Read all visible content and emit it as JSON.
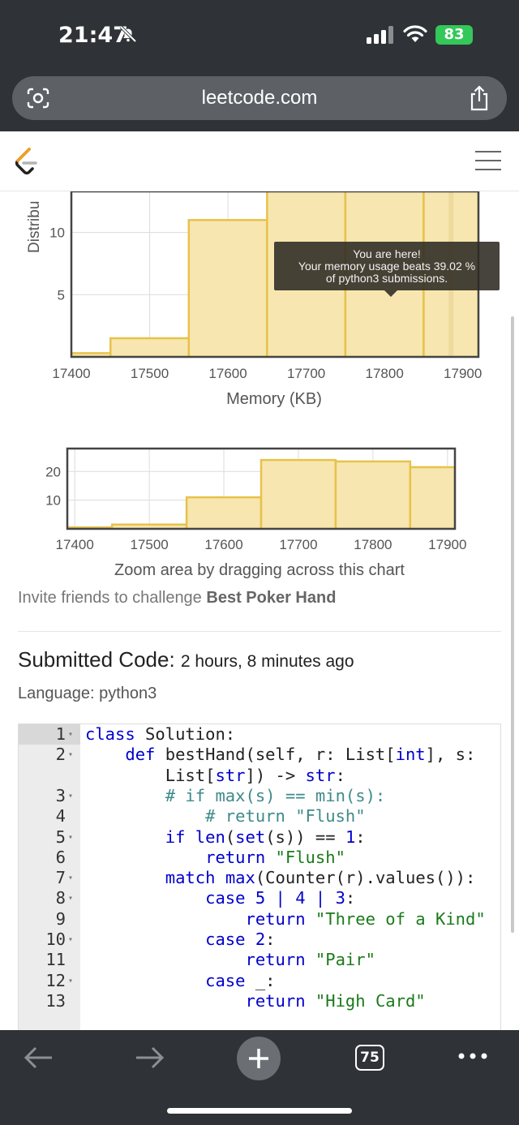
{
  "status_bar": {
    "time": "21:47",
    "battery": "83"
  },
  "browser": {
    "url": "leetcode.com"
  },
  "memory_chart": {
    "tooltip": {
      "line1": "You are here!",
      "line2": "Your memory usage beats 39.02 %",
      "line3": "of python3 submissions."
    },
    "ylabel": "Distribu",
    "xlabel": "Memory (KB)"
  },
  "chart_data": [
    {
      "type": "bar",
      "xlabel": "Memory (KB)",
      "ylabel": "Distribu",
      "x_ticks": [
        "17400",
        "17500",
        "17600",
        "17700",
        "17800",
        "17900"
      ],
      "y_ticks": [
        "5",
        "10"
      ],
      "bins": [
        {
          "from": 17400,
          "to": 17450,
          "value": 0.3
        },
        {
          "from": 17450,
          "to": 17550,
          "value": 1.5
        },
        {
          "from": 17550,
          "to": 17650,
          "value": 11
        },
        {
          "from": 17650,
          "to": 17750,
          "value": 24
        },
        {
          "from": 17750,
          "to": 17850,
          "value": 23.5
        },
        {
          "from": 17850,
          "to": 17920,
          "value": 22
        }
      ],
      "xlim": [
        17400,
        17920
      ],
      "ylim": [
        0,
        13.3
      ],
      "highlight": 17885
    },
    {
      "type": "bar",
      "x_ticks": [
        "17400",
        "17500",
        "17600",
        "17700",
        "17800",
        "17900"
      ],
      "y_ticks": [
        "10",
        "20"
      ],
      "bins": [
        {
          "from": 17390,
          "to": 17450,
          "value": 0.5
        },
        {
          "from": 17450,
          "to": 17550,
          "value": 1.5
        },
        {
          "from": 17550,
          "to": 17650,
          "value": 11
        },
        {
          "from": 17650,
          "to": 17750,
          "value": 24
        },
        {
          "from": 17750,
          "to": 17850,
          "value": 23.5
        },
        {
          "from": 17850,
          "to": 17910,
          "value": 21.5
        }
      ],
      "xlim": [
        17390,
        17910
      ],
      "ylim": [
        0,
        28
      ]
    }
  ],
  "navigator": {
    "hint": "Zoom area by dragging across this chart"
  },
  "invite": {
    "prefix": "Invite friends to challenge ",
    "problem": "Best Poker Hand"
  },
  "submission": {
    "heading": "Submitted Code:",
    "time_ago": "2 hours, 8 minutes ago",
    "language": "Language: python3"
  },
  "code_lines": [
    {
      "n": "1",
      "fold": true,
      "text": "class Solution:"
    },
    {
      "n": "2",
      "fold": true,
      "text": "    def bestHand(self, r: List[int], s:"
    },
    {
      "n": "",
      "fold": false,
      "text": "        List[str]) -> str:"
    },
    {
      "n": "3",
      "fold": true,
      "text": "        # if max(s) == min(s):"
    },
    {
      "n": "4",
      "fold": false,
      "text": "            # return \"Flush\""
    },
    {
      "n": "5",
      "fold": true,
      "text": "        if len(set(s)) == 1:"
    },
    {
      "n": "6",
      "fold": false,
      "text": "            return \"Flush\""
    },
    {
      "n": "7",
      "fold": true,
      "text": "        match max(Counter(r).values()):"
    },
    {
      "n": "8",
      "fold": true,
      "text": "            case 5 | 4 | 3:"
    },
    {
      "n": "9",
      "fold": false,
      "text": "                return \"Three of a Kind\""
    },
    {
      "n": "10",
      "fold": true,
      "text": "            case 2:"
    },
    {
      "n": "11",
      "fold": false,
      "text": "                return \"Pair\""
    },
    {
      "n": "12",
      "fold": true,
      "text": "            case _:"
    },
    {
      "n": "13",
      "fold": false,
      "text": "                return \"High Card\""
    }
  ],
  "bottom_bar": {
    "tab_count": "75"
  },
  "colors": {
    "bar_fill": "#f7e6b0",
    "bar_stroke": "#e8c24a",
    "chrome": "#2f3236",
    "battery": "#34c759"
  }
}
